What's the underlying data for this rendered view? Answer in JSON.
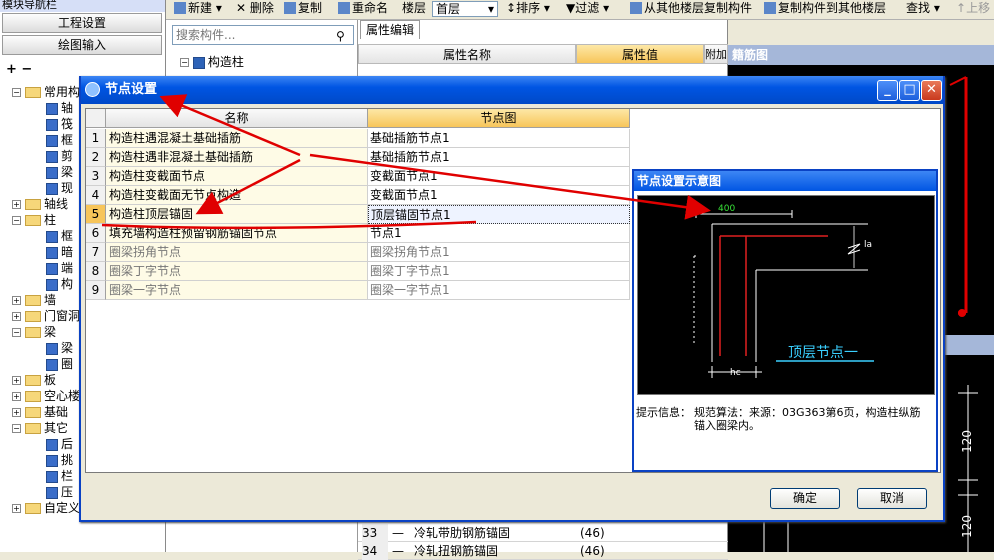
{
  "leftnav": {
    "title": "模块导航栏",
    "btn_project": "工程设置",
    "btn_drawing": "绘图输入",
    "tree": [
      {
        "label": "常用构",
        "level": 0,
        "exp": "−"
      },
      {
        "label": "轴",
        "level": 1
      },
      {
        "label": "筏",
        "level": 1
      },
      {
        "label": "框",
        "level": 1
      },
      {
        "label": "剪",
        "level": 1
      },
      {
        "label": "梁",
        "level": 1
      },
      {
        "label": "现",
        "level": 1
      },
      {
        "label": "轴线",
        "level": 0,
        "exp": "+"
      },
      {
        "label": "柱",
        "level": 0,
        "exp": "−"
      },
      {
        "label": "框",
        "level": 1
      },
      {
        "label": "暗",
        "level": 1
      },
      {
        "label": "端",
        "level": 1
      },
      {
        "label": "构",
        "level": 1
      },
      {
        "label": "墙",
        "level": 0,
        "exp": "+"
      },
      {
        "label": "门窗洞",
        "level": 0,
        "exp": "+"
      },
      {
        "label": "梁",
        "level": 0,
        "exp": "−"
      },
      {
        "label": "梁",
        "level": 1
      },
      {
        "label": "圈",
        "level": 1
      },
      {
        "label": "板",
        "level": 0,
        "exp": "+"
      },
      {
        "label": "空心楼",
        "level": 0,
        "exp": "+"
      },
      {
        "label": "基础",
        "level": 0,
        "exp": "+"
      },
      {
        "label": "其它",
        "level": 0,
        "exp": "−"
      },
      {
        "label": "后",
        "level": 1
      },
      {
        "label": "挑",
        "level": 1
      },
      {
        "label": "栏",
        "level": 1
      },
      {
        "label": "压",
        "level": 1
      },
      {
        "label": "自定义",
        "level": 0,
        "exp": "+"
      }
    ]
  },
  "toolbar": {
    "new": "新建",
    "delete": "删除",
    "copy": "复制",
    "rename": "重命名",
    "floor_label": "楼层",
    "floor_value": "首层",
    "sort": "排序",
    "filter": "过滤",
    "copy_from": "从其他楼层复制构件",
    "copy_to": "复制构件到其他楼层",
    "find": "查找",
    "up": "上移"
  },
  "midpanel": {
    "search_placeholder": "搜索构件...",
    "tree_root": "构造柱"
  },
  "attrpanel": {
    "tab": "属性编辑",
    "col_name": "属性名称",
    "col_value": "属性值",
    "col_extra": "附加",
    "rows": [
      {
        "num": "33",
        "name": "冷轧带肋钢筋锚固",
        "value": "(46)"
      },
      {
        "num": "34",
        "name": "冷轧扭钢筋锚固",
        "value": "(46)"
      }
    ]
  },
  "rebar": {
    "title": "籍筋图",
    "dim": "120"
  },
  "dialog": {
    "title": "节点设置",
    "col_name": "名称",
    "col_node": "节点图",
    "rows": [
      {
        "num": "1",
        "name": "构造柱遇混凝土基础插筋",
        "node": "基础插筋节点1",
        "dim": false
      },
      {
        "num": "2",
        "name": "构造柱遇非混凝土基础插筋",
        "node": "基础插筋节点1",
        "dim": false
      },
      {
        "num": "3",
        "name": "构造柱变截面节点",
        "node": "变截面节点1",
        "dim": false
      },
      {
        "num": "4",
        "name": "构造柱变截面无节点构造",
        "node": "变截面节点1",
        "dim": false
      },
      {
        "num": "5",
        "name": "构造柱顶层锚固",
        "node": "顶层锚固节点1",
        "dim": false
      },
      {
        "num": "6",
        "name": "填充墙构造柱预留钢筋锚固节点",
        "node": "节点1",
        "dim": false
      },
      {
        "num": "7",
        "name": "圈梁拐角节点",
        "node": "圈梁拐角节点1",
        "dim": true
      },
      {
        "num": "8",
        "name": "圈梁丁字节点",
        "node": "圈梁丁字节点1",
        "dim": true
      },
      {
        "num": "9",
        "name": "圈梁一字节点",
        "node": "圈梁一字节点1",
        "dim": true
      }
    ],
    "preview_title": "节点设置示意图",
    "preview_dim": "400",
    "preview_la": "la",
    "preview_hc": "hc",
    "preview_caption": "顶层节点一",
    "hint_label": "提示信息：",
    "hint_text": "规范算法：来源：03G363第6页，构造柱纵筋锚入圈梁内。",
    "ok": "确定",
    "cancel": "取消"
  }
}
